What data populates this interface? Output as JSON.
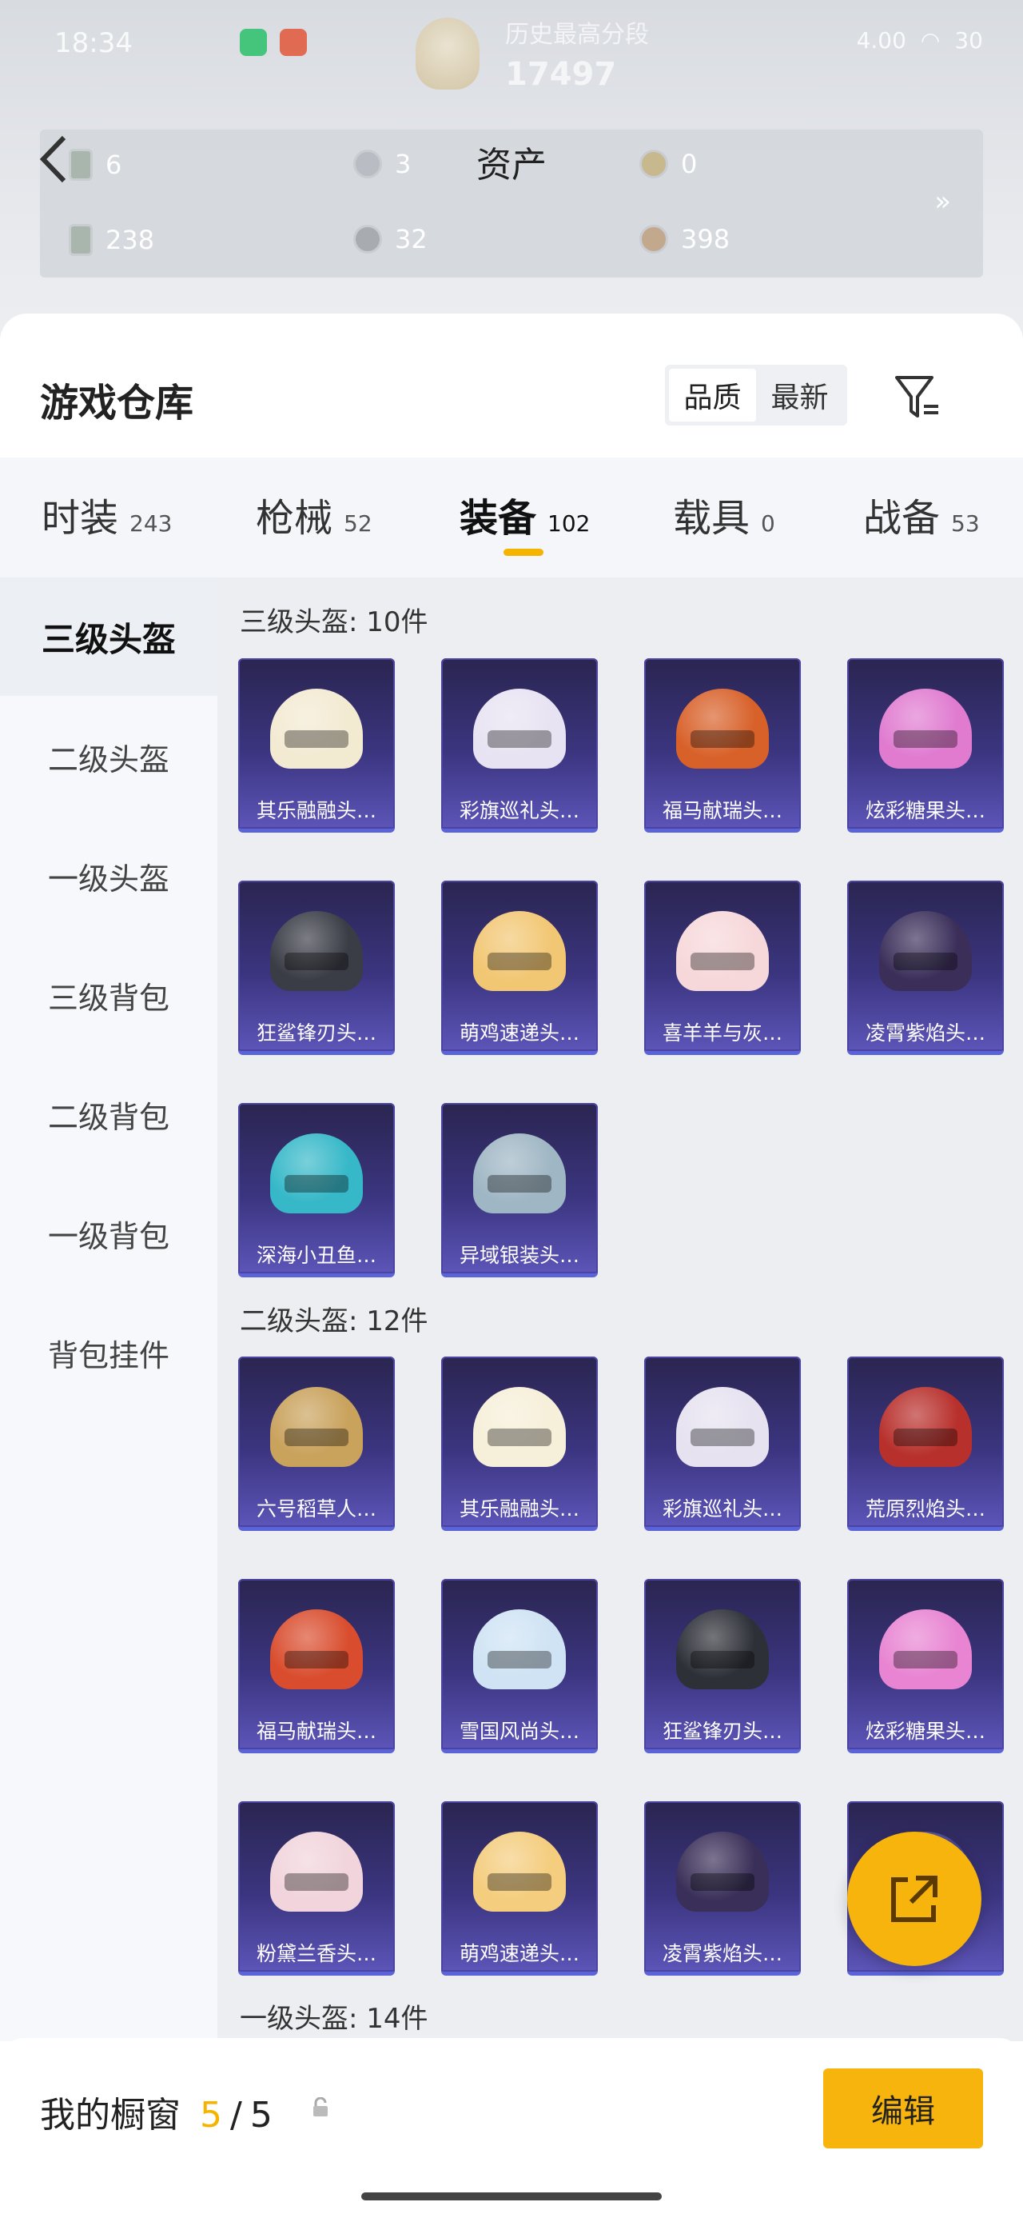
{
  "status_bar": {
    "time": "18:34",
    "network": "4.00",
    "battery": "30"
  },
  "rank": {
    "title": "历史最高分段",
    "score": "17497"
  },
  "assets": {
    "title": "资产",
    "items": [
      {
        "icon": "voucher-icon",
        "value": "6"
      },
      {
        "icon": "silver-coin-icon",
        "value": "3"
      },
      {
        "icon": "gold-coin-icon",
        "value": "0"
      },
      {
        "icon": "ticket-icon",
        "value": "238"
      },
      {
        "icon": "gray-coin-icon",
        "value": "32"
      },
      {
        "icon": "bronze-coin-icon",
        "value": "398"
      }
    ],
    "more": "»"
  },
  "warehouse": {
    "title": "游戏仓库",
    "sort_options": [
      "品质",
      "最新"
    ],
    "sort_selected": "品质",
    "filter_icon": "filter-icon"
  },
  "tabs": [
    {
      "label": "时装",
      "count": "243"
    },
    {
      "label": "枪械",
      "count": "52"
    },
    {
      "label": "装备",
      "count": "102",
      "active": true
    },
    {
      "label": "载具",
      "count": "0"
    },
    {
      "label": "战备",
      "count": "53"
    }
  ],
  "sidebar": [
    {
      "label": "三级头盔",
      "active": true
    },
    {
      "label": "二级头盔"
    },
    {
      "label": "一级头盔"
    },
    {
      "label": "三级背包"
    },
    {
      "label": "二级背包"
    },
    {
      "label": "一级背包"
    },
    {
      "label": "背包挂件"
    }
  ],
  "sections": [
    {
      "title": "三级头盔: 10件",
      "items": [
        {
          "name": "其乐融融头…",
          "color": "#f3ead2"
        },
        {
          "name": "彩旗巡礼头…",
          "color": "#e8e3f2"
        },
        {
          "name": "福马献瑞头…",
          "color": "#d8612a"
        },
        {
          "name": "炫彩糖果头…",
          "color": "#e07bd0"
        },
        {
          "name": "狂鲨锋刃头…",
          "color": "#3a3c46"
        },
        {
          "name": "萌鸡速递头…",
          "color": "#f2c774"
        },
        {
          "name": "喜羊羊与灰…",
          "color": "#f7d8da"
        },
        {
          "name": "凌霄紫焰头…",
          "color": "#3b2f5a"
        },
        {
          "name": "深海小丑鱼…",
          "color": "#36b8c8"
        },
        {
          "name": "异域银装头…",
          "color": "#9fb6c4"
        }
      ]
    },
    {
      "title": "二级头盔: 12件",
      "items": [
        {
          "name": "六号稻草人…",
          "color": "#c9a25c"
        },
        {
          "name": "其乐融融头…",
          "color": "#f6efd9"
        },
        {
          "name": "彩旗巡礼头…",
          "color": "#e6e2f0"
        },
        {
          "name": "荒原烈焰头…",
          "color": "#b8302c"
        },
        {
          "name": "福马献瑞头…",
          "color": "#d94d2e"
        },
        {
          "name": "雪国风尚头…",
          "color": "#cfe3f4"
        },
        {
          "name": "狂鲨锋刃头…",
          "color": "#2e3038"
        },
        {
          "name": "炫彩糖果头…",
          "color": "#e884d2"
        },
        {
          "name": "粉黛兰香头…",
          "color": "#f1d4dc"
        },
        {
          "name": "萌鸡速递头…",
          "color": "#f4cd7e"
        },
        {
          "name": "凌霄紫焰头…",
          "color": "#3a2f58"
        },
        {
          "name": "",
          "color": "#4a4590"
        }
      ]
    },
    {
      "title": "一级头盔: 14件",
      "items": []
    }
  ],
  "bottom": {
    "label": "我的橱窗",
    "count_current": "5",
    "count_sep": "/",
    "count_total": "5",
    "edit": "编辑"
  },
  "colors": {
    "accent": "#f6b40d",
    "card_bg": "#3b3580"
  }
}
